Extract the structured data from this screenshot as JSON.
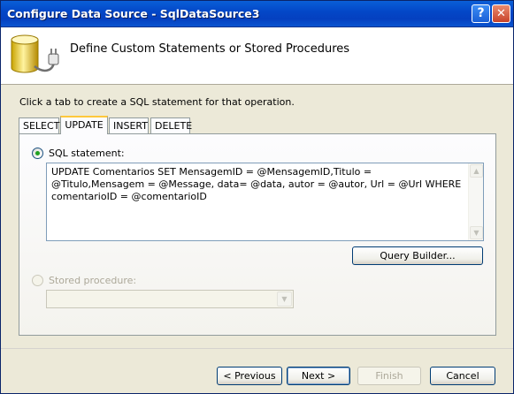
{
  "window": {
    "title": "Configure Data Source - SqlDataSource3",
    "help_glyph": "?",
    "close_glyph": "✕"
  },
  "header": {
    "icon": "database-plug-icon",
    "title": "Define Custom Statements or Stored Procedures"
  },
  "instruction": "Click a tab to create a SQL statement for that operation.",
  "tabs": [
    {
      "label": "SELECT",
      "active": false
    },
    {
      "label": "UPDATE",
      "active": true
    },
    {
      "label": "INSERT",
      "active": false
    },
    {
      "label": "DELETE",
      "active": false
    }
  ],
  "sql_statement": {
    "label": "SQL statement:",
    "selected": true,
    "value": "UPDATE Comentarios SET MensagemID = @MensagemID,Titulo = @Titulo,Mensagem = @Message, data= @data, autor = @autor, Url = @Url WHERE comentarioID = @comentarioID"
  },
  "query_builder_label": "Query Builder...",
  "stored_procedure": {
    "label": "Stored procedure:",
    "selected": false,
    "enabled": false,
    "value": ""
  },
  "buttons": {
    "previous": "< Previous",
    "next": "Next >",
    "finish": "Finish",
    "cancel": "Cancel"
  },
  "colors": {
    "titlebar": "#0348c8",
    "active_tab_accent": "#ffc83c",
    "radio_selected": "#21a121"
  }
}
